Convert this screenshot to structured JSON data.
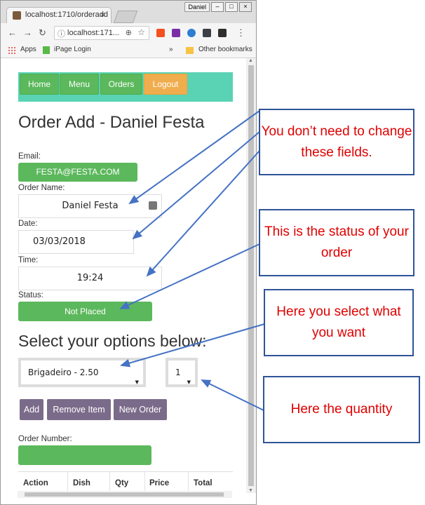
{
  "browser": {
    "tab_title": "localhost:1710/orderadd",
    "tab_close": "×",
    "user_badge": "Daniel",
    "window_buttons": [
      "–",
      "□",
      "×"
    ],
    "url": "localhost:171...",
    "bookmarks": {
      "apps": "Apps",
      "ipage": "iPage Login",
      "more": "»",
      "other": "Other bookmarks"
    }
  },
  "nav": {
    "home": "Home",
    "menu": "Menu",
    "orders": "Orders",
    "logout": "Logout"
  },
  "page": {
    "title": "Order Add - Daniel Festa",
    "email_label": "Email:",
    "email_value": "FESTA@FESTA.COM",
    "order_name_label": "Order Name:",
    "order_name_value": "Daniel Festa",
    "date_label": "Date:",
    "date_value": "03/03/2018",
    "time_label": "Time:",
    "time_value": "19:24",
    "status_label": "Status:",
    "status_value": "Not Placed",
    "options_heading": "Select your options below:",
    "dish_selected": "Brigadeiro - 2.50",
    "qty_selected": "1",
    "buttons": {
      "add": "Add",
      "remove": "Remove Item",
      "new_order": "New Order"
    },
    "order_number_label": "Order Number:",
    "order_number_value": "",
    "table_headers": [
      "Action",
      "Dish",
      "Qty",
      "Price",
      "Total"
    ]
  },
  "callouts": {
    "no_change": "You don’t need to change these fields.",
    "status": "This is the status of your order",
    "select": "Here you select what you want",
    "quantity": "Here the quantity"
  },
  "colors": {
    "green": "#5cb85c",
    "teal": "#5ad3b4",
    "orange": "#f0ad4e",
    "purple": "#7b6b8a",
    "callout_border": "#2f5497",
    "callout_text": "#e00000",
    "arrow": "#4472c4"
  }
}
